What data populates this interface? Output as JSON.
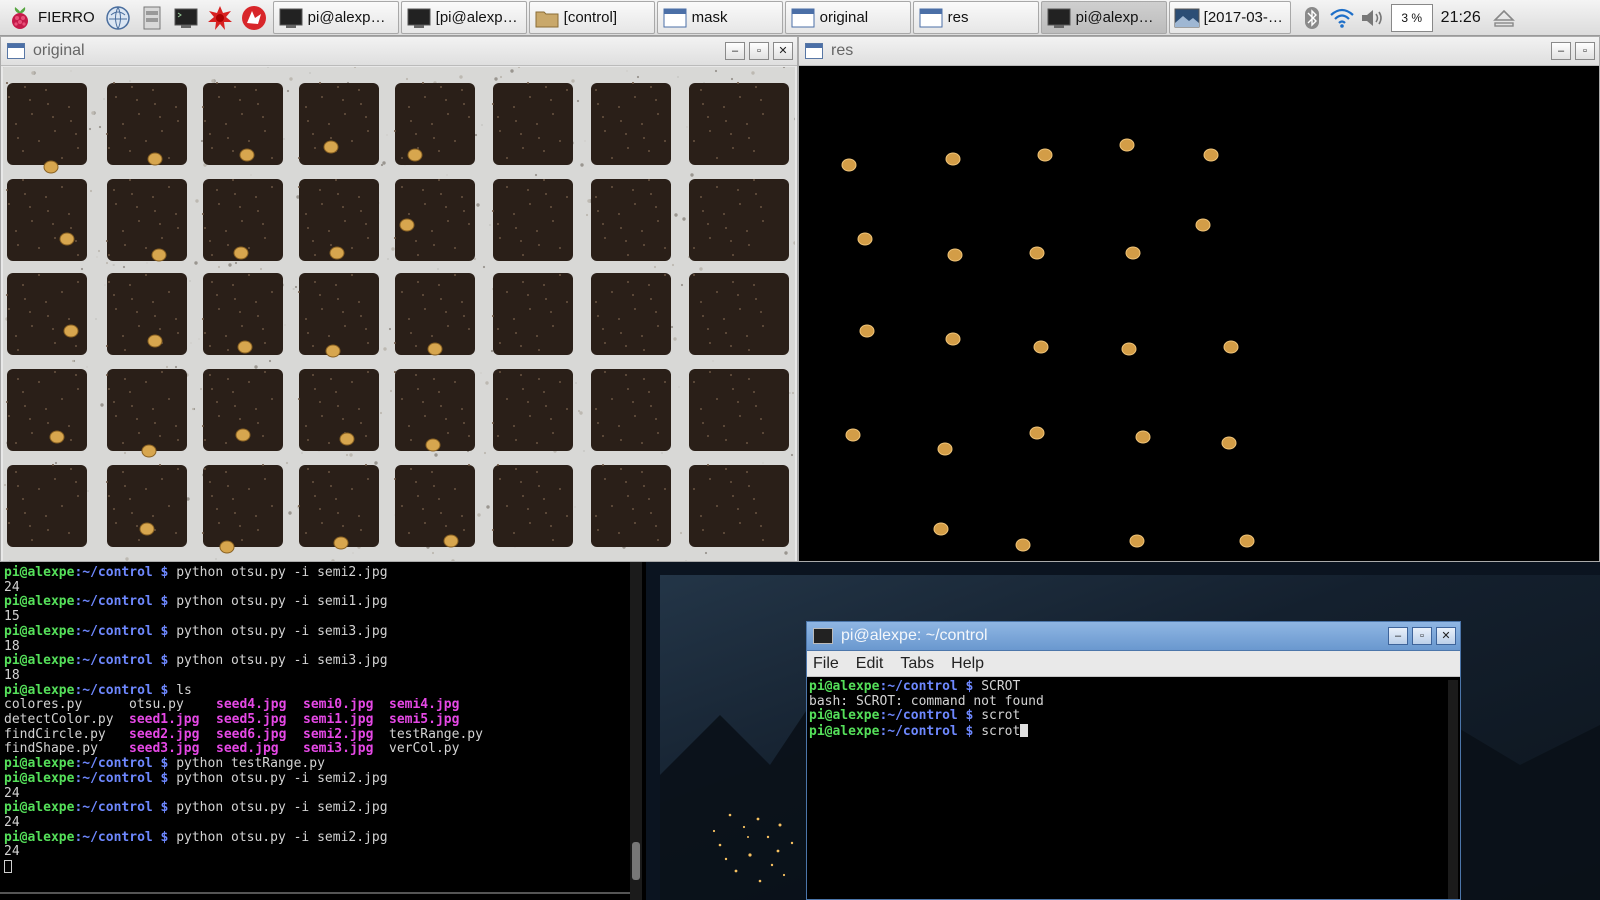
{
  "taskbar": {
    "menu_label": "FIERRO",
    "launchers": [
      "web-browser-icon",
      "file-manager-icon",
      "terminal-icon",
      "math-kernel-icon",
      "wolfram-icon"
    ],
    "tasks": [
      {
        "label": "pi@alexpe: ...",
        "icon": "terminal-icon",
        "active": false
      },
      {
        "label": "[pi@alexpe:...",
        "icon": "terminal-icon",
        "active": false
      },
      {
        "label": "[control]",
        "icon": "folder-icon",
        "active": false
      },
      {
        "label": "mask",
        "icon": "window-icon",
        "active": false
      },
      {
        "label": "original",
        "icon": "window-icon",
        "active": false
      },
      {
        "label": "res",
        "icon": "window-icon",
        "active": false
      },
      {
        "label": "pi@alexpe: ...",
        "icon": "terminal-icon",
        "active": true
      },
      {
        "label": "[2017-03-2...",
        "icon": "image-icon",
        "active": false
      }
    ],
    "cpu": "3 %",
    "clock": "21:26"
  },
  "windows": {
    "original": {
      "title": "original"
    },
    "res": {
      "title": "res"
    },
    "terminal2": {
      "title": "pi@alexpe: ~/control",
      "menu": [
        "File",
        "Edit",
        "Tabs",
        "Help"
      ]
    }
  },
  "terminal_left": {
    "user": "pi@alexpe",
    "path": ":~/control $ ",
    "lines": [
      {
        "p": true,
        "cmd": "python otsu.py -i semi2.jpg"
      },
      {
        "out": "24"
      },
      {
        "p": true,
        "cmd": "python otsu.py -i semi1.jpg"
      },
      {
        "out": "15"
      },
      {
        "p": true,
        "cmd": "python otsu.py -i semi3.jpg"
      },
      {
        "out": "18"
      },
      {
        "p": true,
        "cmd": "python otsu.py -i semi3.jpg"
      },
      {
        "out": "18"
      },
      {
        "p": true,
        "cmd": "ls"
      },
      {
        "ls": [
          "colores.py",
          "otsu.py",
          "seed4.jpg",
          "semi0.jpg",
          "semi4.jpg"
        ]
      },
      {
        "ls": [
          "detectColor.py",
          "seed1.jpg",
          "seed5.jpg",
          "semi1.jpg",
          "semi5.jpg"
        ]
      },
      {
        "ls": [
          "findCircle.py",
          "seed2.jpg",
          "seed6.jpg",
          "semi2.jpg",
          "testRange.py"
        ]
      },
      {
        "ls": [
          "findShape.py",
          "seed3.jpg",
          "seed.jpg",
          "semi3.jpg",
          "verCol.py"
        ]
      },
      {
        "p": true,
        "cmd": "python testRange.py"
      },
      {
        "p": true,
        "cmd": "python otsu.py -i semi2.jpg"
      },
      {
        "out": "24"
      },
      {
        "p": true,
        "cmd": "python otsu.py -i semi2.jpg"
      },
      {
        "out": "24"
      },
      {
        "p": true,
        "cmd": "python otsu.py -i semi2.jpg"
      },
      {
        "out": "24"
      }
    ]
  },
  "terminal_right": {
    "user": "pi@alexpe",
    "path": ":~/control $ ",
    "lines": [
      {
        "p": true,
        "cmd": "SCROT"
      },
      {
        "out": "bash: SCROT: command not found"
      },
      {
        "p": true,
        "cmd": "scrot"
      },
      {
        "p": true,
        "cmd": "scrot",
        "cursor": true
      }
    ]
  },
  "colors": {
    "prompt_user": "#55e05a",
    "prompt_path": "#6e88ff",
    "ls_image": "#e648e6",
    "titlebar_active": "#6a98cf"
  }
}
